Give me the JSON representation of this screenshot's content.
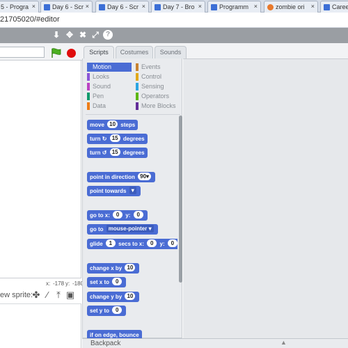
{
  "browser": {
    "tabs": [
      {
        "title": "5 - Progra",
        "color": "#f0a030"
      },
      {
        "title": "Day 6 - Scr",
        "color": "#3c6fd6"
      },
      {
        "title": "Day 6 - Scr",
        "color": "#3c6fd6"
      },
      {
        "title": "Day 7 - Bro",
        "color": "#3c6fd6"
      },
      {
        "title": "Programm",
        "color": "#3c6fd6"
      },
      {
        "title": "zombie ori",
        "color": "#e8792c"
      },
      {
        "title": "Caree",
        "color": "#3c6fd6"
      }
    ],
    "close_glyph": "×",
    "url": "21705020/#editor"
  },
  "scratch_toolbar": {
    "icons": [
      "stamp-icon",
      "grow-icon",
      "shrink-icon",
      "expand-icon",
      "help-icon"
    ]
  },
  "stage": {
    "coords_x_label": "x:",
    "coords_x": "-178",
    "coords_y_label": "y:",
    "coords_y": "-180",
    "new_sprite_label": "ew sprite:"
  },
  "editor_tabs": [
    "Scripts",
    "Costumes",
    "Sounds"
  ],
  "categories": {
    "left": [
      {
        "label": "Motion",
        "color": "#4a6cd4",
        "active": true
      },
      {
        "label": "Looks",
        "color": "#8a55d7"
      },
      {
        "label": "Sound",
        "color": "#bb42c3"
      },
      {
        "label": "Pen",
        "color": "#0e9a6c"
      },
      {
        "label": "Data",
        "color": "#ee7d16"
      }
    ],
    "right": [
      {
        "label": "Events",
        "color": "#c88330"
      },
      {
        "label": "Control",
        "color": "#e1a91a"
      },
      {
        "label": "Sensing",
        "color": "#2ca5e2"
      },
      {
        "label": "Operators",
        "color": "#5cb712"
      },
      {
        "label": "More Blocks",
        "color": "#632d99"
      }
    ]
  },
  "blocks": {
    "move": {
      "pre": "move",
      "value": "10",
      "post": "steps"
    },
    "turn_right": {
      "pre": "turn",
      "icon": "↻",
      "value": "15",
      "post": "degrees"
    },
    "turn_left": {
      "pre": "turn",
      "icon": "↺",
      "value": "15",
      "post": "degrees"
    },
    "point_direction": {
      "pre": "point in direction",
      "value": "90▾"
    },
    "point_towards": {
      "pre": "point towards",
      "value": "▾"
    },
    "go_to_xy": {
      "pre": "go to x:",
      "x": "0",
      "mid": "y:",
      "y": "0"
    },
    "go_to": {
      "pre": "go to",
      "value": "mouse-pointer ▾"
    },
    "glide": {
      "pre": "glide",
      "secs": "1",
      "mid": "secs to x:",
      "x": "0",
      "mid2": "y:",
      "y": "0"
    },
    "change_x": {
      "pre": "change x by",
      "value": "10"
    },
    "set_x": {
      "pre": "set x to",
      "value": "0"
    },
    "change_y": {
      "pre": "change y by",
      "value": "10"
    },
    "set_y": {
      "pre": "set y to",
      "value": "0"
    },
    "bounce": {
      "pre": "if on edge, bounce"
    }
  },
  "backpack": {
    "label": "Backpack",
    "arrow": "▲"
  }
}
